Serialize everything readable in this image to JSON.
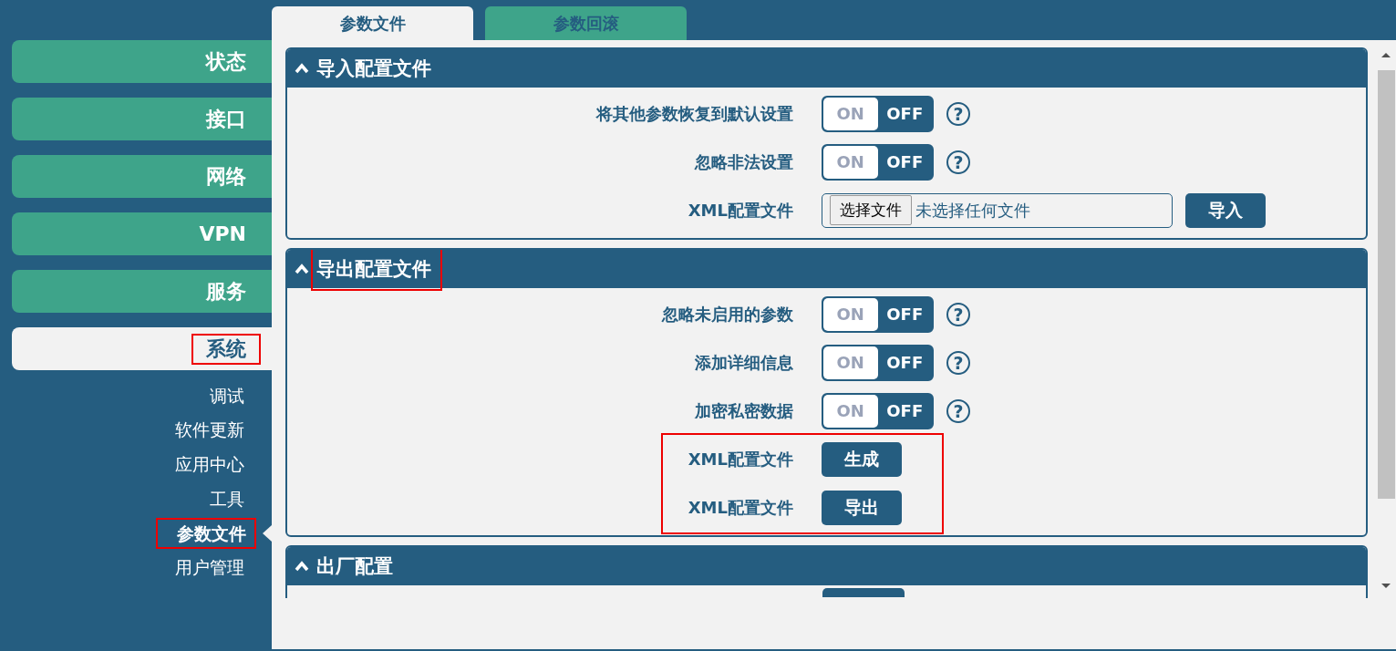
{
  "sidebar": {
    "items": [
      {
        "label": "状态",
        "selected": false,
        "highlighted": false
      },
      {
        "label": "接口",
        "selected": false,
        "highlighted": false
      },
      {
        "label": "网络",
        "selected": false,
        "highlighted": false
      },
      {
        "label": "VPN",
        "selected": false,
        "highlighted": false
      },
      {
        "label": "服务",
        "selected": false,
        "highlighted": false
      },
      {
        "label": "系统",
        "selected": true,
        "highlighted": true,
        "children": [
          {
            "label": "调试",
            "selected": false,
            "highlighted": false
          },
          {
            "label": "软件更新",
            "selected": false,
            "highlighted": false
          },
          {
            "label": "应用中心",
            "selected": false,
            "highlighted": false
          },
          {
            "label": "工具",
            "selected": false,
            "highlighted": false
          },
          {
            "label": "参数文件",
            "selected": true,
            "highlighted": true
          },
          {
            "label": "用户管理",
            "selected": false,
            "highlighted": false
          }
        ]
      }
    ]
  },
  "tabs": [
    {
      "label": "参数文件",
      "selected": true
    },
    {
      "label": "参数回滚",
      "selected": false
    }
  ],
  "sections": [
    {
      "title": "导入配置文件",
      "expanded": true,
      "highlighted": false,
      "rows": [
        {
          "kind": "toggle",
          "label": "将其他参数恢复到默认设置",
          "on": false,
          "on_text": "ON",
          "off_text": "OFF",
          "help": "?"
        },
        {
          "kind": "toggle",
          "label": "忽略非法设置",
          "on": false,
          "on_text": "ON",
          "off_text": "OFF",
          "help": "?"
        },
        {
          "kind": "file",
          "label": "XML配置文件",
          "choose": "选择文件",
          "file_name": "未选择任何文件",
          "button": "导入"
        }
      ]
    },
    {
      "title": "导出配置文件",
      "expanded": true,
      "highlighted": true,
      "rows": [
        {
          "kind": "toggle",
          "label": "忽略未启用的参数",
          "on": false,
          "on_text": "ON",
          "off_text": "OFF",
          "help": "?"
        },
        {
          "kind": "toggle",
          "label": "添加详细信息",
          "on": false,
          "on_text": "ON",
          "off_text": "OFF",
          "help": "?"
        },
        {
          "kind": "toggle",
          "label": "加密私密数据",
          "on": false,
          "on_text": "ON",
          "off_text": "OFF",
          "help": "?"
        },
        {
          "kind": "button",
          "label": "XML配置文件",
          "button": "生成",
          "highlighted": true
        },
        {
          "kind": "button",
          "label": "XML配置文件",
          "button": "导出",
          "highlighted": true
        }
      ]
    },
    {
      "title": "出厂配置",
      "expanded": true,
      "highlighted": false
    }
  ]
}
